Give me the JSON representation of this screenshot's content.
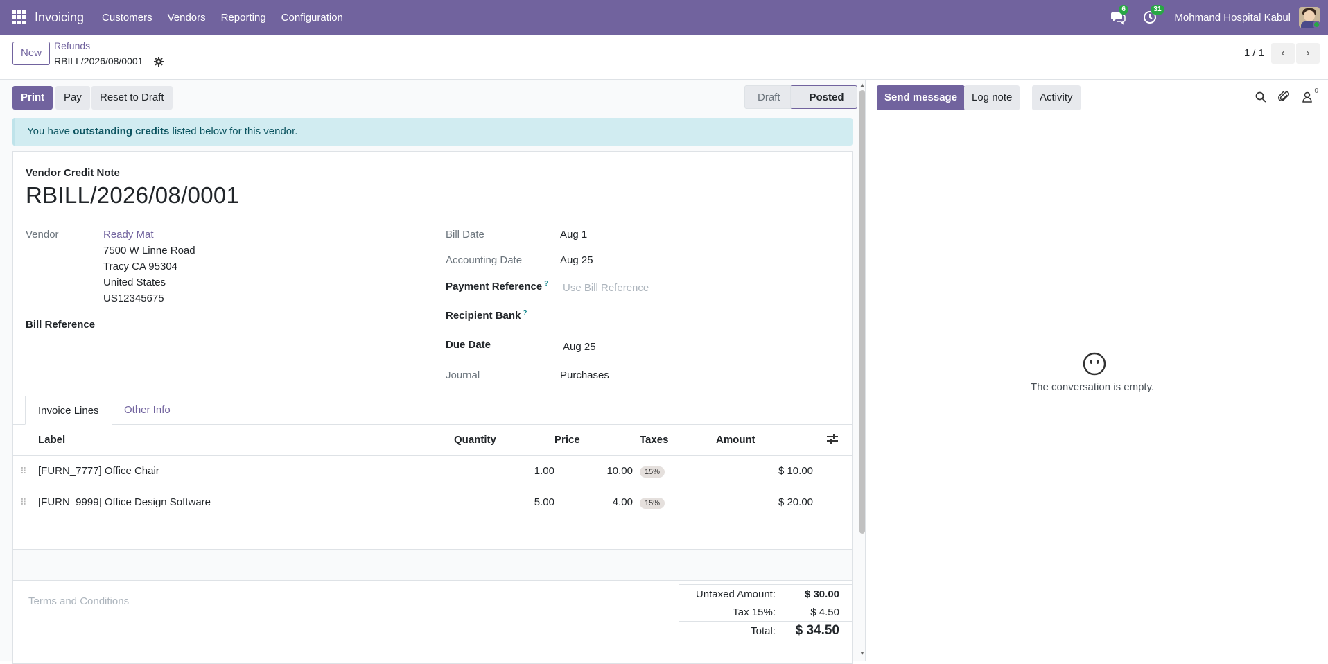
{
  "topbar": {
    "app_name": "Invoicing",
    "menu": [
      "Customers",
      "Vendors",
      "Reporting",
      "Configuration"
    ],
    "messages_badge": "6",
    "activities_badge": "31",
    "company": "Mohmand Hospital Kabul",
    "brand_color": "#71639e"
  },
  "control": {
    "new_label": "New",
    "breadcrumb_parent": "Refunds",
    "breadcrumb_current": "RBILL/2026/08/0001",
    "pager": "1 / 1"
  },
  "actions": {
    "print": "Print",
    "pay": "Pay",
    "reset": "Reset to Draft"
  },
  "status": {
    "draft": "Draft",
    "posted": "Posted",
    "current": "Posted"
  },
  "alert": {
    "prefix": "You have ",
    "bold": "outstanding credits",
    "suffix": " listed below for this vendor."
  },
  "document": {
    "type": "Vendor Credit Note",
    "name": "RBILL/2026/08/0001",
    "vendor_label": "Vendor",
    "vendor_name": "Ready Mat",
    "vendor_address": [
      "7500 W Linne Road",
      "Tracy CA 95304",
      "United States",
      "US12345675"
    ],
    "bill_reference_label": "Bill Reference",
    "bill_date_label": "Bill Date",
    "bill_date": "Aug 1",
    "accounting_date_label": "Accounting Date",
    "accounting_date": "Aug 25",
    "payment_reference_label": "Payment Reference",
    "payment_reference_placeholder": "Use Bill Reference",
    "recipient_bank_label": "Recipient Bank",
    "due_date_label": "Due Date",
    "due_date": "Aug 25",
    "journal_label": "Journal",
    "journal": "Purchases",
    "help_mark": "?"
  },
  "tabs": [
    "Invoice Lines",
    "Other Info"
  ],
  "lines": {
    "headers": {
      "label": "Label",
      "quantity": "Quantity",
      "price": "Price",
      "taxes": "Taxes",
      "amount": "Amount"
    },
    "rows": [
      {
        "label": "[FURN_7777] Office Chair",
        "quantity": "1.00",
        "price": "10.00",
        "tax": "15%",
        "amount": "$ 10.00"
      },
      {
        "label": "[FURN_9999] Office Design Software",
        "quantity": "5.00",
        "price": "4.00",
        "tax": "15%",
        "amount": "$ 20.00"
      }
    ]
  },
  "terms_placeholder": "Terms and Conditions",
  "totals": {
    "untaxed_label": "Untaxed Amount:",
    "untaxed": "$ 30.00",
    "tax_label": "Tax 15%:",
    "tax": "$ 4.50",
    "total_label": "Total:",
    "total": "$ 34.50"
  },
  "chatter": {
    "send_message": "Send message",
    "log_note": "Log note",
    "activity": "Activity",
    "followers_count": "0",
    "empty_text": "The conversation is empty."
  }
}
